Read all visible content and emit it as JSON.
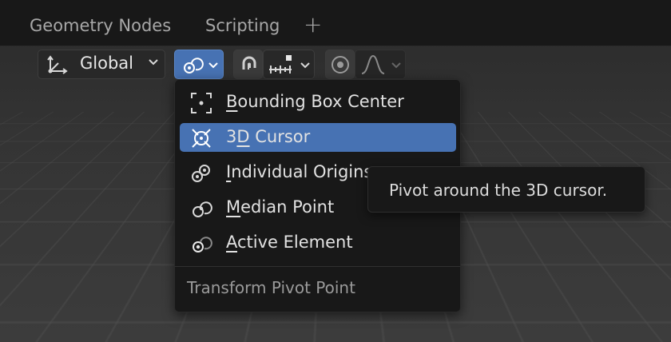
{
  "workspace_tabs": [
    {
      "label": "Geometry Nodes"
    },
    {
      "label": "Scripting"
    }
  ],
  "add_workspace_symbol": "+",
  "header": {
    "transform_orientation": "Global",
    "pivot_icon": "pivot-point-icon",
    "snap_icon": "magnet-icon",
    "snap_target_icon": "snap-increment-icon",
    "proportional_icon": "proportional-edit-icon",
    "falloff_icon": "falloff-curve-icon"
  },
  "pivot_menu": {
    "items": [
      {
        "first": "B",
        "rest": "ounding Box Center",
        "icon": "bounding-box-center-icon",
        "selected": false
      },
      {
        "first": "3",
        "pre": "",
        "mid": "D",
        "rest": " Cursor",
        "icon": "3d-cursor-icon",
        "selected": true
      },
      {
        "first": "I",
        "rest": "ndividual Origins",
        "icon": "individual-origins-icon",
        "selected": false
      },
      {
        "first": "M",
        "rest": "edian Point",
        "icon": "median-point-icon",
        "selected": false
      },
      {
        "first": "A",
        "rest": "ctive Element",
        "icon": "active-element-icon",
        "selected": false
      }
    ],
    "title": "Transform Pivot Point"
  },
  "tooltip": "Pivot around the 3D cursor.",
  "colors": {
    "accent": "#4772b3",
    "menu_bg": "#181818",
    "topbar_bg": "#181818"
  }
}
